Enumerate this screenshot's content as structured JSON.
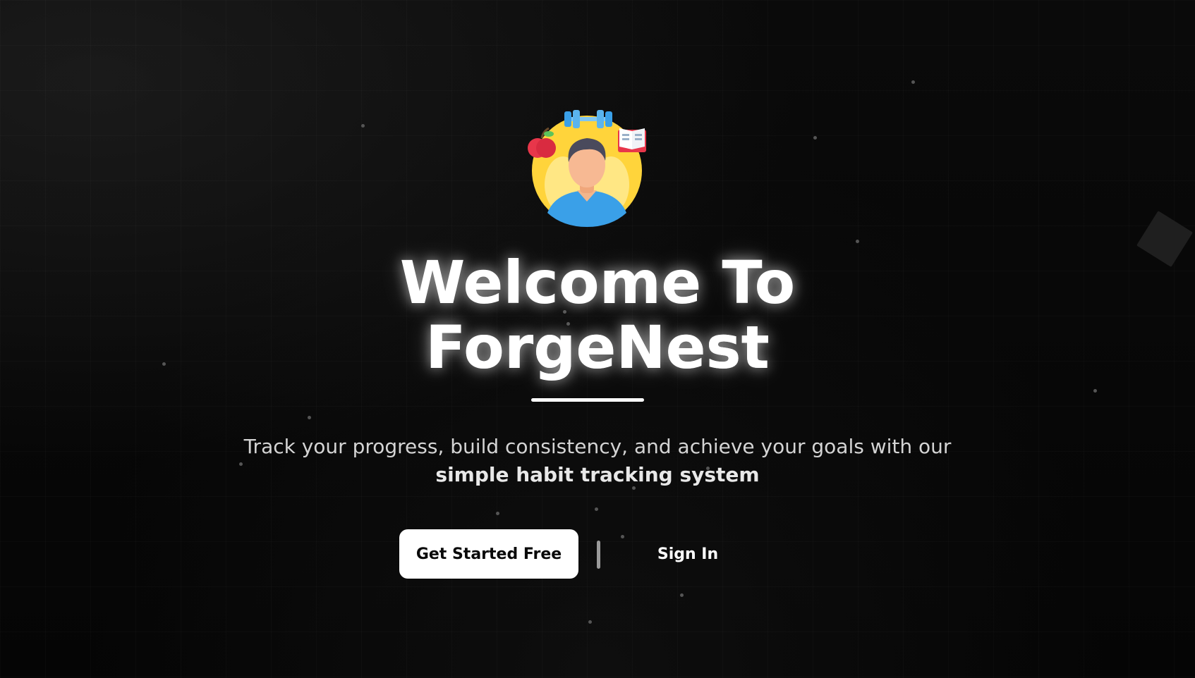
{
  "hero": {
    "title_line1": "Welcome To",
    "title_line2": "ForgeNest",
    "subtitle": "Track your progress, build consistency, and achieve your goals with our",
    "subtitle_strong": "simple habit tracking system"
  },
  "actions": {
    "primary_label": "Get Started Free",
    "secondary_label": "Sign In"
  },
  "colors": {
    "background": "#060606",
    "text": "#ffffff",
    "primary_button_bg": "#ffffff",
    "primary_button_text": "#0a0a0a",
    "avatar_yellow": "#ffd43b",
    "avatar_blue": "#3aa0e8"
  },
  "icons": [
    "person-avatar-icon",
    "dumbbell-icon",
    "apple-icon",
    "book-icon"
  ]
}
